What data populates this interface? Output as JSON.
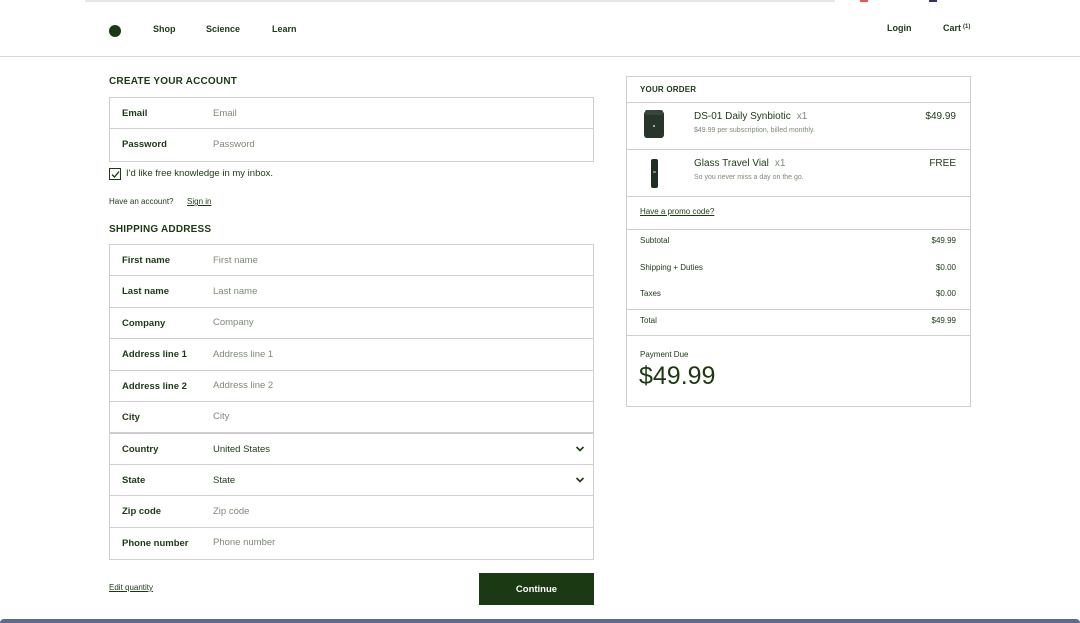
{
  "nav": {
    "shop": "Shop",
    "science": "Science",
    "learn": "Learn",
    "login": "Login",
    "cart": "Cart",
    "cart_count": "(1)"
  },
  "account": {
    "title": "CREATE YOUR ACCOUNT",
    "email_label": "Email",
    "email_placeholder": "Email",
    "password_label": "Password",
    "password_placeholder": "Password",
    "newsletter_label": "I'd like free knowledge in my inbox.",
    "newsletter_checked": true,
    "have_account": "Have an account?",
    "sign_in": "Sign in"
  },
  "shipping": {
    "title": "SHIPPING ADDRESS",
    "first_name_label": "First name",
    "first_name_placeholder": "First name",
    "last_name_label": "Last name",
    "last_name_placeholder": "Last name",
    "company_label": "Company",
    "company_placeholder": "Company",
    "address1_label": "Address line 1",
    "address1_placeholder": "Address line 1",
    "address2_label": "Address line 2",
    "address2_placeholder": "Address line 2",
    "city_label": "City",
    "city_placeholder": "City",
    "country_label": "Country",
    "country_value": "United States",
    "state_label": "State",
    "state_value": "State",
    "zip_label": "Zip code",
    "zip_placeholder": "Zip code",
    "phone_label": "Phone number",
    "phone_placeholder": "Phone number"
  },
  "footer": {
    "edit_quantity": "Edit quantity",
    "continue": "Continue"
  },
  "order": {
    "title": "YOUR ORDER",
    "items": [
      {
        "name": "DS-01 Daily Synbiotic",
        "qty": "x1",
        "subtitle": "$49.99 per subscription, billed monthly.",
        "price": "$49.99",
        "icon": "jar-icon"
      },
      {
        "name": "Glass Travel Vial",
        "qty": "x1",
        "subtitle": "So you never miss a day on the go.",
        "price": "FREE",
        "icon": "vial-icon"
      }
    ],
    "promo": "Have a promo code?",
    "subtotal_label": "Subtotal",
    "subtotal_value": "$49.99",
    "shipping_label": "Shipping + Duties",
    "shipping_value": "$0.00",
    "taxes_label": "Taxes",
    "taxes_value": "$0.00",
    "total_label": "Total",
    "total_value": "$49.99",
    "payment_due_label": "Payment Due",
    "payment_due_value": "$49.99"
  },
  "colors": {
    "brand": "#1b3a14",
    "muted": "#7d8a78",
    "border": "#cfcfcf"
  }
}
